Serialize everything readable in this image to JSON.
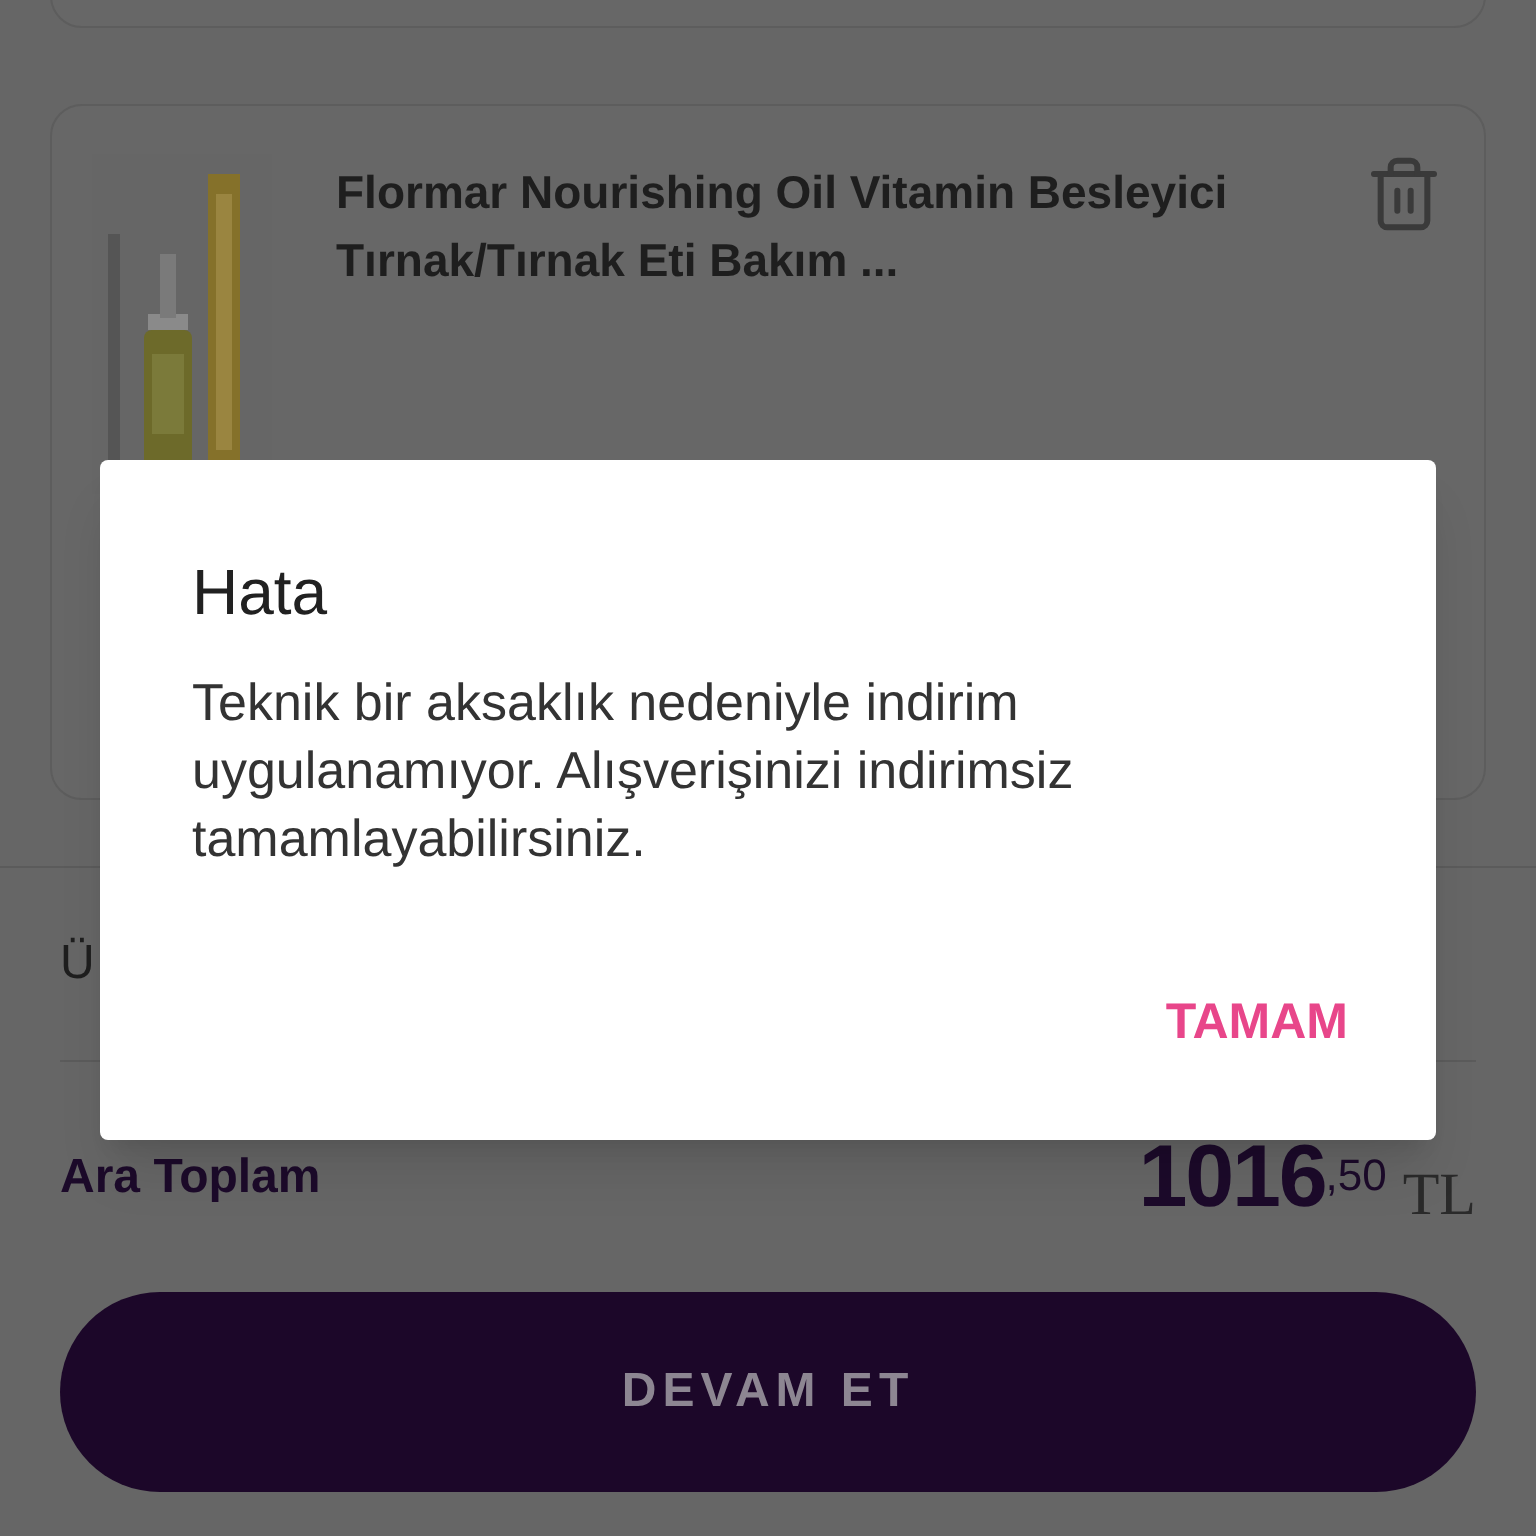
{
  "cart_item": {
    "kind": "picture",
    "title": "Flormar Nourishing Oil Vitamin Besleyici Tırnak/Tırnak Eti Bakım ..."
  },
  "summary_row": {
    "label": "Ü"
  },
  "subtotal": {
    "label": "Ara Toplam",
    "whole": "1016",
    "fraction": ",50",
    "currency": "TL"
  },
  "continue_button": "DEVAM ET",
  "dialog": {
    "title": "Hata",
    "message": "Teknik bir aksaklık nedeniyle indirim uygulanamıyor. Alışverişinizi indirimsiz tamamlayabilirsiniz.",
    "button": "TAMAM"
  }
}
